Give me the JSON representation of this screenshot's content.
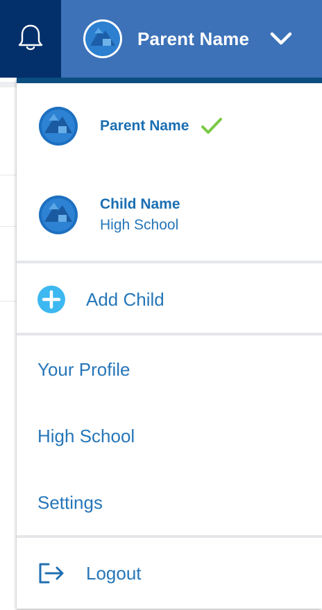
{
  "header": {
    "account_name": "Parent Name"
  },
  "dropdown": {
    "profiles": [
      {
        "name": "Parent Name",
        "subtitle": "",
        "selected": true
      },
      {
        "name": "Child Name",
        "subtitle": "High School",
        "selected": false
      }
    ],
    "add_child_label": "Add Child",
    "links": [
      {
        "label": "Your Profile"
      },
      {
        "label": "High School"
      },
      {
        "label": "Settings"
      }
    ],
    "logout_label": "Logout"
  },
  "icons": {
    "bell": "bell-icon",
    "chevron": "chevron-down-icon",
    "check": "check-icon",
    "add": "plus-circle-icon",
    "logout": "logout-icon"
  },
  "colors": {
    "bell_bg": "#03306b",
    "header_bg": "#3d72b8",
    "accent_bar": "#0c4d80",
    "link_text": "#2676b8",
    "name_text": "#1b6fb2",
    "check": "#7ac943",
    "add_icon": "#3db8f0",
    "divider": "#e4e6e9"
  }
}
